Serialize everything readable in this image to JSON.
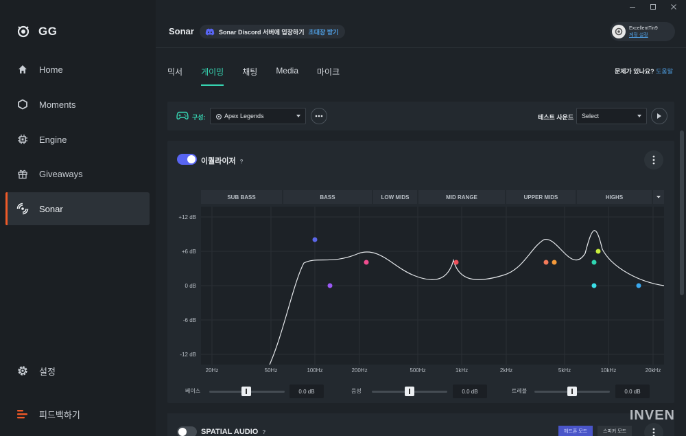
{
  "sidebar": {
    "logo": "GG",
    "items": [
      {
        "label": "Home",
        "icon": "home-icon"
      },
      {
        "label": "Moments",
        "icon": "hexagon-icon"
      },
      {
        "label": "Engine",
        "icon": "chip-icon"
      },
      {
        "label": "Giveaways",
        "icon": "gift-icon"
      },
      {
        "label": "Sonar",
        "icon": "sonar-icon",
        "active": true
      }
    ],
    "settings": "설정",
    "feedback": "피드백하기"
  },
  "header": {
    "title": "Sonar",
    "discord_text": "Sonar Discord 서버에 입장하기",
    "discord_link": "초대장 받기",
    "account_name": "ExcellentTin9",
    "account_link": "계정 설정"
  },
  "tabs": [
    "믹서",
    "게이밍",
    "채팅",
    "Media",
    "마이크"
  ],
  "active_tab": "게이밍",
  "help": {
    "text": "문제가 있나요?",
    "link": "도움말"
  },
  "config": {
    "label": "구성:",
    "preset": "Apex Legends",
    "test_sound_label": "테스트 사운드",
    "test_sound_value": "Select"
  },
  "equalizer": {
    "title": "이퀄라이저",
    "help_mark": "?",
    "enabled": true,
    "bands": [
      "SUB BASS",
      "BASS",
      "LOW MIDS",
      "MID RANGE",
      "UPPER MIDS",
      "HIGHS"
    ],
    "y_ticks": [
      "+12 dB",
      "+6 dB",
      "0 dB",
      "-6 dB",
      "-12 dB"
    ],
    "x_ticks": [
      "20Hz",
      "50Hz",
      "100Hz",
      "200Hz",
      "500Hz",
      "1kHz",
      "2kHz",
      "5kHz",
      "10kHz",
      "20kHz"
    ],
    "sliders": [
      {
        "label": "베이스",
        "value": "0.0 dB"
      },
      {
        "label": "음성",
        "value": "0.0 dB"
      },
      {
        "label": "트레블",
        "value": "0.0 dB"
      }
    ],
    "colors": {
      "accent": "#5865f2",
      "curve": "#e6e9ec"
    }
  },
  "spatial": {
    "title": "SPATIAL AUDIO",
    "help_mark": "?",
    "enabled": false,
    "mode_headphone": "헤드폰 모드",
    "mode_speaker": "스피커 모드"
  },
  "watermark": "INVEN"
}
